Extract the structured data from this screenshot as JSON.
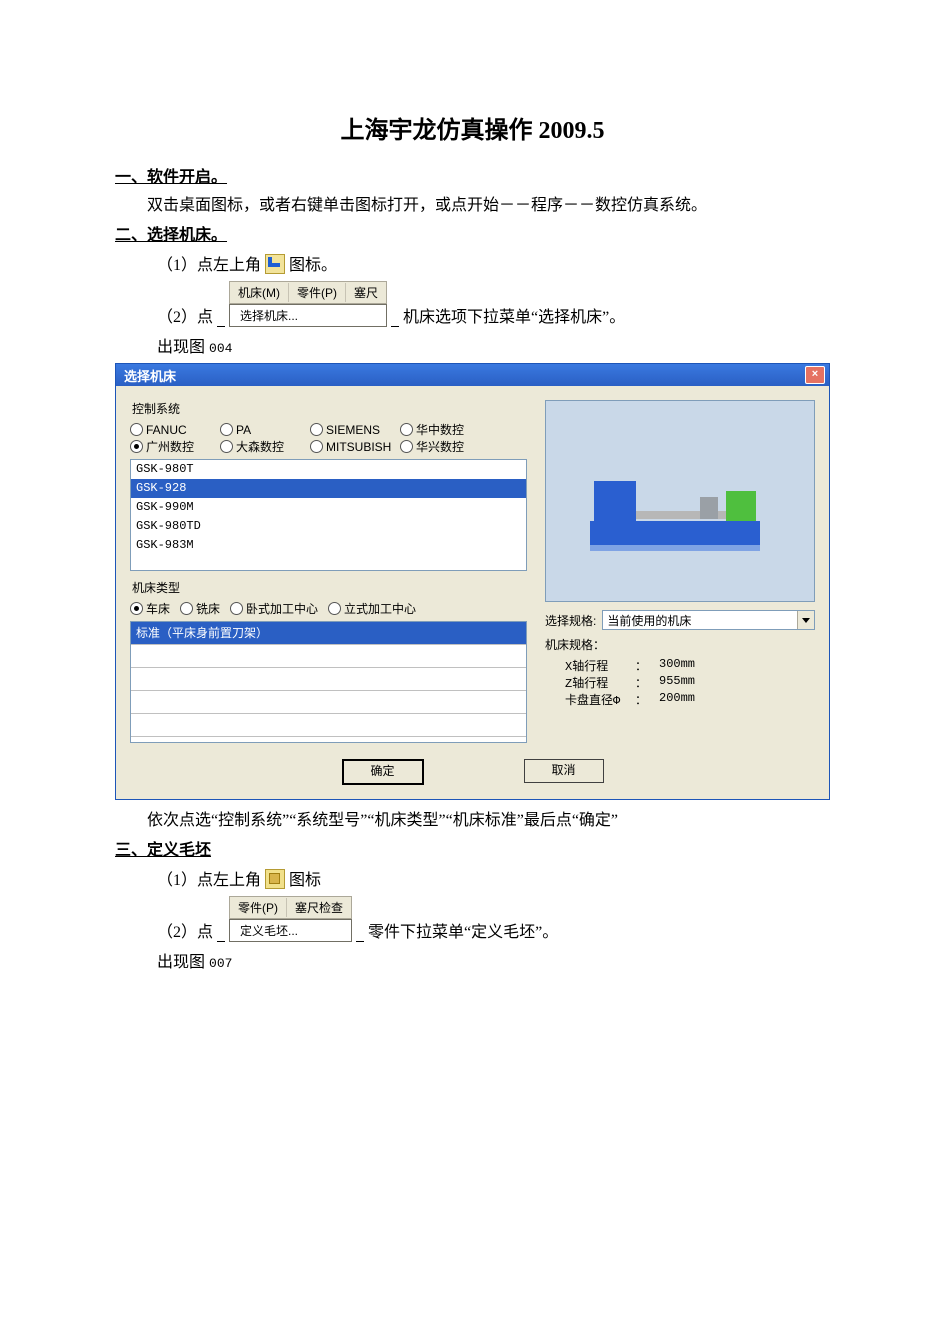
{
  "title": "上海宇龙仿真操作 2009.5",
  "h1": "一、软件开启。",
  "p1": "双击桌面图标，或者右键单击图标打开，或点开始－－程序－－数控仿真系统。",
  "h2": "二、选择机床。",
  "s2_1_a": "（1）点左上角",
  "s2_1_b": "图标。",
  "menubar1": {
    "m0": "机床(M)",
    "m1": "零件(P)",
    "m2": "塞尺"
  },
  "menudrop1": "选择机床...",
  "s2_2_a": "（2）点",
  "s2_2_b": "机床选项下拉菜单“选择机床”。",
  "s2_fig": "出现图",
  "s2_fig_no": "004",
  "dialog": {
    "title": "选择机床",
    "close": "×",
    "ctrl_label": "控制系统",
    "ctrl": [
      "FANUC",
      "PA",
      "SIEMENS",
      "华中数控",
      "广州数控",
      "大森数控",
      "MITSUBISH",
      "华兴数控"
    ],
    "models": [
      "GSK-980T",
      "GSK-928",
      "GSK-990M",
      "GSK-980TD",
      "GSK-983M"
    ],
    "type_label": "机床类型",
    "types": [
      "车床",
      "铣床",
      "卧式加工中心",
      "立式加工中心"
    ],
    "standard": "标准（平床身前置刀架）",
    "spec_label": "选择规格:",
    "spec_sel": "当前使用的机床",
    "spec_title": "机床规格：",
    "spec": [
      {
        "k": "X轴行程",
        "v": "300mm"
      },
      {
        "k": "Z轴行程",
        "v": "955mm"
      },
      {
        "k": "卡盘直径Φ",
        "v": "200mm"
      }
    ],
    "ok": "确定",
    "cancel": "取消"
  },
  "s2_after": "依次点选“控制系统”“系统型号”“机床类型”“机床标准”最后点“确定”",
  "h3": "三、定义毛坯",
  "s3_1_a": "（1）点左上角",
  "s3_1_b": "图标",
  "menubar2": {
    "m0": "零件(P)",
    "m1": "塞尺检查"
  },
  "menudrop2": "定义毛坯...",
  "s3_2_a": "（2）点",
  "s3_2_b": "零件下拉菜单“定义毛坯”。",
  "s3_fig": "出现图",
  "s3_fig_no": "007"
}
